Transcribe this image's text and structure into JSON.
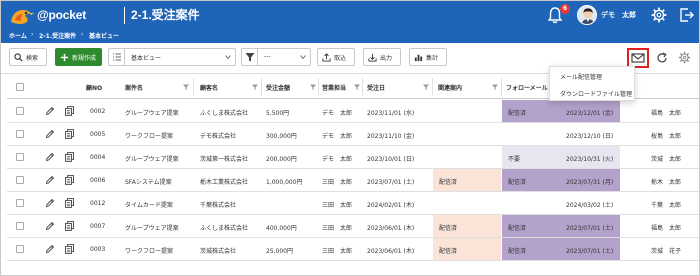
{
  "header": {
    "app_name": "pocket",
    "page_title": "2-1.受注案件",
    "notification_count": "6",
    "user_name": "デモ　太郎"
  },
  "breadcrumb": [
    "ホーム",
    "2-1.受注案件",
    "基本ビュー"
  ],
  "toolbar": {
    "search": "検索",
    "new": "新規作成",
    "view": "基本ビュー",
    "filter": "---",
    "import": "取込",
    "export": "出力",
    "aggregate": "集計"
  },
  "dropdown": {
    "items": [
      "メール配信管理",
      "ダウンロードファイル管理"
    ]
  },
  "columns": [
    "顧NO",
    "案件名",
    "顧客名",
    "受注金額",
    "営業担当",
    "受注日",
    "関連案内",
    "フォローメール",
    "",
    ""
  ],
  "rows": [
    {
      "no": "0002",
      "project": "グループウェア提案",
      "customer": "ふくしま株式会社",
      "amount": "5,500円",
      "rep": "デモ　太郎",
      "date": "2023/11/01 (水)",
      "related": "",
      "follow": "配信済",
      "date2": "2023/12/01 (金)",
      "person": "福島　太郎"
    },
    {
      "no": "0005",
      "project": "ワークフロー提案",
      "customer": "デモ株式会社",
      "amount": "300,000円",
      "rep": "デモ　太郎",
      "date": "2023/11/10 (金)",
      "related": "",
      "follow": "",
      "date2": "2023/12/10 (日)",
      "person": "桜島　太郎"
    },
    {
      "no": "0004",
      "project": "グループウェア提案",
      "customer": "茨城第一株式会社",
      "amount": "200,000円",
      "rep": "デモ　太郎",
      "date": "2023/10/01 (日)",
      "related": "",
      "follow": "不要",
      "date2": "2023/10/31 (火)",
      "person": "茨城　太郎"
    },
    {
      "no": "0006",
      "project": "SFAシステム提案",
      "customer": "栃木工業株式会社",
      "amount": "1,000,000円",
      "rep": "三田　太郎",
      "date": "2023/07/01 (土)",
      "related": "配信済",
      "follow": "配信済",
      "date2": "2023/07/31 (月)",
      "person": "栃木　太郎"
    },
    {
      "no": "0012",
      "project": "タイムカード提案",
      "customer": "千葉株式会社",
      "amount": "",
      "rep": "三田　太郎",
      "date": "2024/02/01 (木)",
      "related": "",
      "follow": "",
      "date2": "2024/03/02 (土)",
      "person": "千葉　太郎"
    },
    {
      "no": "0007",
      "project": "グループウェア提案",
      "customer": "ふくしま株式会社",
      "amount": "400,000円",
      "rep": "三田　太郎",
      "date": "2023/06/01 (木)",
      "related": "配信済",
      "follow": "配信済",
      "date2": "2023/07/01 (土)",
      "person": "福島　太郎"
    },
    {
      "no": "0003",
      "project": "ワークフロー提案",
      "customer": "茨城株式会社",
      "amount": "25,000円",
      "rep": "三田　太郎",
      "date": "2023/06/01 (木)",
      "related": "配信済",
      "follow": "配信済",
      "date2": "2023/07/01 (土)",
      "person": "茨城　花子"
    }
  ],
  "colors": {
    "brand": "#1e64b8",
    "new_button": "#2e8a2e",
    "related_cell": "#fbe3d8",
    "follow_sent": "#b3a2cc",
    "follow_other": "#e8e4f0",
    "highlight": "#e02020"
  },
  "icons": [
    "bird-logo-icon",
    "bell-icon",
    "gear-icon",
    "logout-icon",
    "search-icon",
    "plus-icon",
    "list-icon",
    "filter-icon",
    "upload-icon",
    "download-icon",
    "chart-icon",
    "mail-icon",
    "refresh-icon",
    "pencil-icon",
    "copy-icon"
  ]
}
